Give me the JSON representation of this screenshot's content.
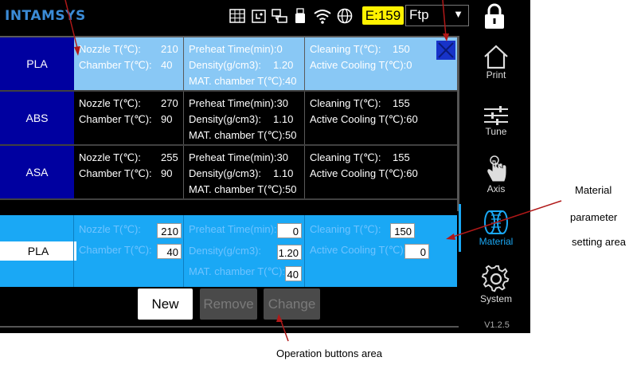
{
  "topbar": {
    "logo": "INTAMSYS",
    "energy": "E:159",
    "mode": "Ftp",
    "icons": [
      "grid-icon",
      "usb-storage-icon",
      "network-icon",
      "usb-icon",
      "wifi-icon",
      "globe-icon"
    ]
  },
  "materials": [
    {
      "name": "PLA",
      "nozzle_label": "Nozzle T(℃):",
      "nozzle": "210",
      "chamber_label": "Chamber T(℃):",
      "chamber": "40",
      "preheat_label": "Preheat Time(min):",
      "preheat": "0",
      "density_label": "Density(g/cm3):",
      "density": "1.20",
      "mat_label": "MAT. chamber T(℃):",
      "mat": "40",
      "cleaning_label": "Cleaning T(℃):",
      "cleaning": "150",
      "cooling_label": "Active Cooling T(℃):",
      "cooling": "0"
    },
    {
      "name": "ABS",
      "nozzle_label": "Nozzle T(℃):",
      "nozzle": "270",
      "chamber_label": "Chamber T(℃):",
      "chamber": "90",
      "preheat_label": "Preheat Time(min):",
      "preheat": "30",
      "density_label": "Density(g/cm3):",
      "density": "1.10",
      "mat_label": "MAT. chamber T(℃):",
      "mat": "50",
      "cleaning_label": "Cleaning T(℃):",
      "cleaning": "155",
      "cooling_label": "Active Cooling T(℃):",
      "cooling": "60"
    },
    {
      "name": "ASA",
      "nozzle_label": "Nozzle T(℃):",
      "nozzle": "255",
      "chamber_label": "Chamber T(℃):",
      "chamber": "90",
      "preheat_label": "Preheat Time(min):",
      "preheat": "30",
      "density_label": "Density(g/cm3):",
      "density": "1.10",
      "mat_label": "MAT. chamber T(℃):",
      "mat": "50",
      "cleaning_label": "Cleaning T(℃):",
      "cleaning": "155",
      "cooling_label": "Active Cooling T(℃):",
      "cooling": "60"
    }
  ],
  "edit": {
    "name": "PLA",
    "nozzle_label": "Nozzle T(℃):",
    "nozzle": "210",
    "chamber_label": "Chamber T(℃):",
    "chamber": "40",
    "preheat_label": "Preheat Time(min):",
    "preheat": "0",
    "density_label": "Density(g/cm3):",
    "density": "1.20",
    "mat_label": "MAT. chamber T(℃):",
    "mat": "40",
    "cleaning_label": "Cleaning T(℃):",
    "cleaning": "150",
    "cooling_label": "Active Cooling T(℃):",
    "cooling": "0"
  },
  "buttons": {
    "new": "New",
    "remove": "Remove",
    "change": "Change"
  },
  "nav": {
    "print": "Print",
    "tune": "Tune",
    "axis": "Axis",
    "material": "Material",
    "system": "System"
  },
  "version": "V1.2.5",
  "annotations": {
    "material_area_line1": "Material",
    "material_area_line2": "parameter",
    "material_area_line3": "setting area",
    "operation_area": "Operation buttons area"
  },
  "colors": {
    "accent": "#1aa8f5",
    "selected_row": "#89c8f5",
    "name_cell": "#0000a0",
    "energy_badge": "#fff200",
    "annotation_arrow": "#b01818"
  }
}
